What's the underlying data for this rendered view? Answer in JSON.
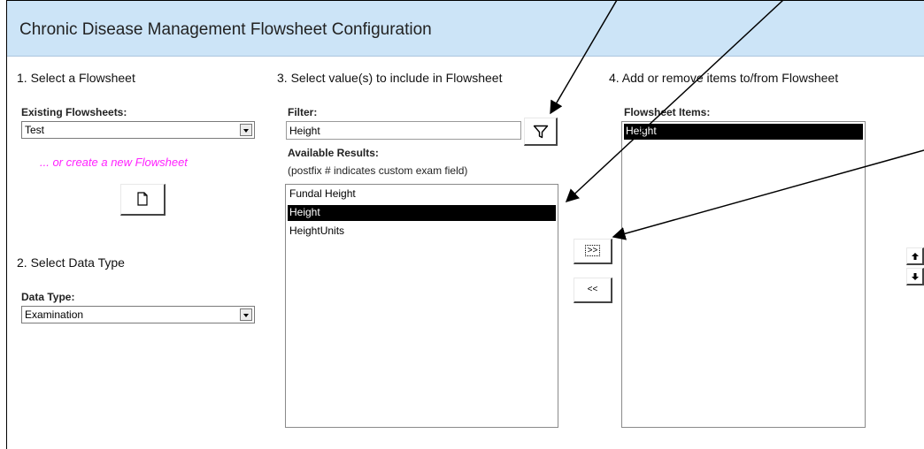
{
  "header": {
    "title": "Chronic Disease Management Flowsheet Configuration"
  },
  "section1": {
    "title": "1. Select a  Flowsheet",
    "existing_label": "Existing Flowsheets:",
    "existing_value": "Test",
    "create_new_text": "... or create a new  Flowsheet"
  },
  "section2": {
    "title": "2. Select Data Type",
    "data_type_label": "Data Type:",
    "data_type_value": "Examination"
  },
  "section3": {
    "title": "3. Select value(s) to include in Flowsheet",
    "filter_label": "Filter:",
    "filter_value": "Height",
    "available_label": "Available Results:",
    "postfix_note": "(postfix # indicates custom exam field)",
    "results": [
      {
        "label": "Fundal Height",
        "selected": false
      },
      {
        "label": "Height",
        "selected": true
      },
      {
        "label": "HeightUnits",
        "selected": false
      }
    ]
  },
  "transfer": {
    "add_label": ">>",
    "remove_label": "<<"
  },
  "section4": {
    "title": "4. Add or remove items to/from Flowsheet",
    "items_label": "Flowsheet Items:",
    "items": [
      {
        "label": "Height",
        "selected": true
      }
    ]
  },
  "colors": {
    "header_bg": "#cce4f7",
    "create_new_text": "#ff22ff",
    "selection_bg": "#000000"
  },
  "icons": [
    "new-document-icon",
    "filter-icon",
    "move-up-icon",
    "move-down-icon"
  ]
}
